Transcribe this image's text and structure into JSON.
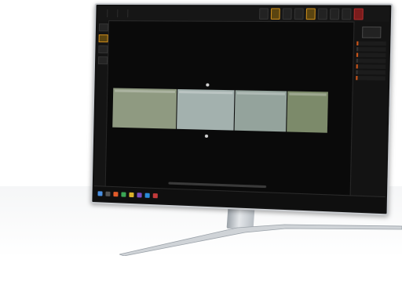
{
  "app": {
    "tabs": [
      "",
      "",
      ""
    ]
  },
  "colors": {
    "accent": "#c88a1a",
    "alert": "#b02b2b",
    "clip_green_1": "#8f9a81",
    "clip_blue": "#9aa8a6",
    "clip_green_2": "#7f8d72"
  },
  "clips": [
    {
      "color": "#8f9a81",
      "label_top": "",
      "label_bottom": ""
    },
    {
      "color": "#a3b1ae",
      "label_top": "",
      "label_bottom": ""
    },
    {
      "color": "#94a39c",
      "label_top": "",
      "label_bottom": ""
    },
    {
      "color": "#7c8a6a",
      "label_top": "",
      "label_bottom": ""
    }
  ],
  "status": {
    "text": ""
  },
  "icons": {
    "markers": [
      "marker-icon",
      "marker-icon"
    ],
    "taskbar": [
      "windows-icon",
      "app-icon",
      "app-icon",
      "app-icon",
      "app-icon",
      "app-icon",
      "app-icon",
      "app-icon"
    ]
  }
}
